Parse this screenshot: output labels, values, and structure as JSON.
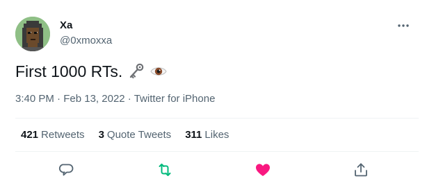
{
  "user": {
    "display_name": "Xa",
    "handle": "@0xmoxxa",
    "avatar_icon": "pixel-punk-avatar"
  },
  "menu_icon": "more-icon",
  "tweet": {
    "text": "First 1000 RTs.",
    "emojis": [
      "old-key-emoji",
      "eye-emoji"
    ]
  },
  "meta": {
    "time": "3:40 PM",
    "separator": "·",
    "date": "Feb 13, 2022",
    "source": "Twitter for iPhone"
  },
  "stats": {
    "retweets_count": "421",
    "retweets_label": "Retweets",
    "quotes_count": "3",
    "quotes_label": "Quote Tweets",
    "likes_count": "311",
    "likes_label": "Likes"
  },
  "actions": {
    "reply_icon": "reply-icon",
    "retweet_icon": "retweet-icon",
    "like_icon": "like-icon",
    "share_icon": "share-icon"
  },
  "colors": {
    "text_primary": "#0f1419",
    "text_secondary": "#536471",
    "retweet_active": "#00ba7c",
    "like_active": "#f91880",
    "divider": "#eff3f4"
  }
}
